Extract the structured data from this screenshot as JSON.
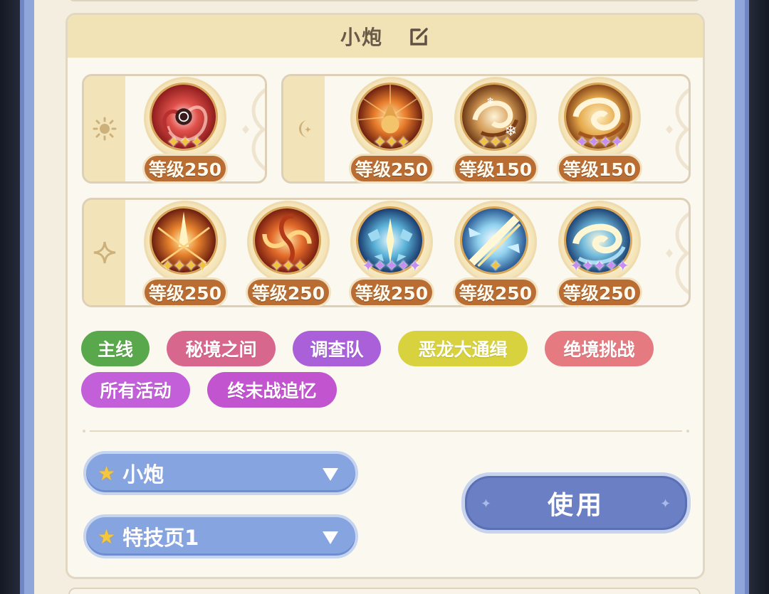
{
  "title": "小炮",
  "colors": {
    "frame": "#8fa6da",
    "card_bg": "#fbf8f0",
    "header_bg": "#f1e3b5",
    "level_badge": "#b96d33",
    "use_button": "#6b80c4",
    "select": "#86a4e0"
  },
  "panels": [
    {
      "rail_icon": "sun-icon",
      "skills": [
        {
          "icon": "red-vortex-skill-icon",
          "stars": 3,
          "star_color": "gold",
          "level": "等级250"
        }
      ]
    },
    {
      "rail_icon": "moon-icon",
      "skills": [
        {
          "icon": "fire-wizard-skill-icon",
          "stars": 3,
          "star_color": "gold",
          "level": "等级250"
        },
        {
          "icon": "snowflake-swirl-skill-icon",
          "stars": 3,
          "star_color": "gold",
          "level": "等级150"
        },
        {
          "icon": "golden-swirl-skill-icon",
          "stars": 4,
          "star_color": "purple",
          "level": "等级150"
        }
      ]
    },
    {
      "rail_icon": "sparkle-icon",
      "skills": [
        {
          "icon": "fire-burst-skill-icon",
          "stars": 4,
          "star_color": "gold",
          "level": "等级250"
        },
        {
          "icon": "fire-swirl-skill-icon",
          "stars": 3,
          "star_color": "gold",
          "level": "等级250"
        },
        {
          "icon": "ice-burst-skill-icon",
          "stars": 5,
          "star_color": "purple",
          "level": "等级250"
        },
        {
          "icon": "ice-slash-skill-icon",
          "stars": 1,
          "star_color": "gold",
          "level": "等级250"
        },
        {
          "icon": "ice-vortex-skill-icon",
          "stars": 5,
          "star_color": "purple",
          "level": "等级250"
        }
      ]
    }
  ],
  "tags": [
    {
      "label": "主线",
      "color": "#59a84b"
    },
    {
      "label": "秘境之间",
      "color": "#d8678e"
    },
    {
      "label": "调查队",
      "color": "#a960d8"
    },
    {
      "label": "恶龙大通缉",
      "color": "#d7d23e"
    },
    {
      "label": "绝境挑战",
      "color": "#e57b80"
    },
    {
      "label": "所有活动",
      "color": "#c35fd9"
    },
    {
      "label": "终末战追忆",
      "color": "#c254cf"
    }
  ],
  "selects": {
    "character": "小炮",
    "page": "特技页1"
  },
  "use_button_label": "使用"
}
